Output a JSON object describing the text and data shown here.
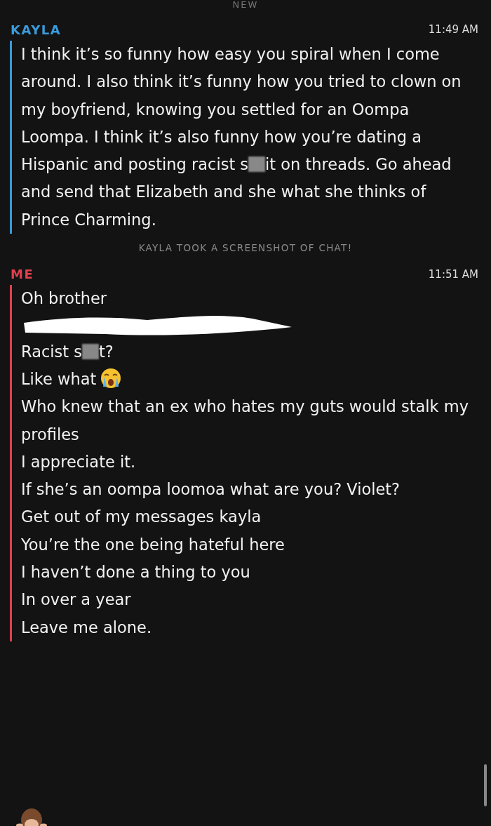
{
  "top_label": "NEW",
  "messages": [
    {
      "sender": "KAYLA",
      "time": "11:49 AM",
      "color": "#3a9bdc",
      "lines": [
        {
          "parts": [
            {
              "text": "I think it’s so funny how easy you spiral when I come around. I also think it’s funny how you tried to clown on my boyfriend, knowing you settled for an Oompa Loompa. I think it’s also funny how you’re dating a Hispanic and posting racist s"
            },
            {
              "kind": "blur"
            },
            {
              "text": "it on threads. Go ahead and send that Elizabeth and she what she thinks of Prince Charming."
            }
          ]
        }
      ]
    },
    {
      "kind": "notice",
      "text": "KAYLA TOOK A SCREENSHOT OF CHAT!"
    },
    {
      "sender": "ME",
      "time": "11:51 AM",
      "color": "#e0404f",
      "lines": [
        {
          "parts": [
            {
              "text": "Oh brother"
            }
          ]
        },
        {
          "parts": [
            {
              "kind": "scribble"
            }
          ]
        },
        {
          "parts": [
            {
              "text": "Racist s"
            },
            {
              "kind": "blur"
            },
            {
              "text": "t?"
            }
          ]
        },
        {
          "parts": [
            {
              "text": "Like what"
            },
            {
              "kind": "emoji"
            }
          ]
        },
        {
          "parts": [
            {
              "text": "Who knew that an ex who hates my guts would stalk my profiles"
            }
          ]
        },
        {
          "parts": [
            {
              "text": "I appreciate it."
            }
          ]
        },
        {
          "parts": [
            {
              "text": "If she’s an oompa loomoa what are you? Violet?"
            }
          ]
        },
        {
          "parts": [
            {
              "text": "Get out of my messages kayla"
            }
          ]
        },
        {
          "parts": [
            {
              "text": "You’re the one being hateful here"
            }
          ]
        },
        {
          "parts": [
            {
              "text": "I haven’t done a thing to you"
            }
          ]
        },
        {
          "parts": [
            {
              "text": "In over a year"
            }
          ]
        },
        {
          "parts": [
            {
              "text": "Leave me alone."
            }
          ]
        }
      ]
    }
  ]
}
